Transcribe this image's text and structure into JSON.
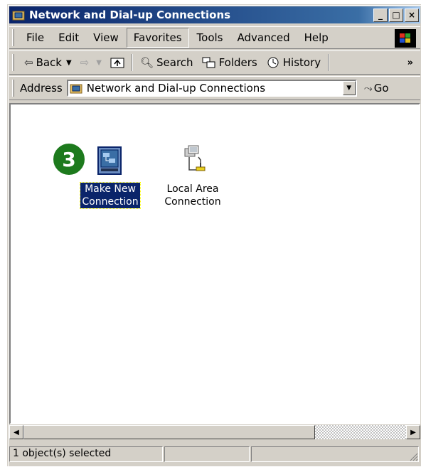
{
  "window": {
    "title": "Network and Dial-up Connections",
    "controls": {
      "minimize": "_",
      "maximize": "□",
      "close": "×"
    }
  },
  "menubar": {
    "items": [
      {
        "label": "File"
      },
      {
        "label": "Edit"
      },
      {
        "label": "View"
      },
      {
        "label": "Favorites",
        "active": true
      },
      {
        "label": "Tools"
      },
      {
        "label": "Advanced"
      },
      {
        "label": "Help"
      }
    ]
  },
  "toolbar": {
    "back": "Back",
    "search": "Search",
    "folders": "Folders",
    "history": "History",
    "more": "»"
  },
  "address": {
    "label": "Address",
    "value": "Network and Dial-up Connections",
    "go": "Go"
  },
  "content": {
    "step_badge": "3",
    "items": [
      {
        "label_line1": "Make New",
        "label_line2": "Connection",
        "icon": "make-new-connection-icon",
        "selected": true
      },
      {
        "label_line1": "Local Area",
        "label_line2": "Connection",
        "icon": "local-area-connection-icon",
        "selected": false
      }
    ]
  },
  "statusbar": {
    "text": "1 object(s) selected"
  },
  "colors": {
    "selection": "#0a246a",
    "titlebar": "#0a246a",
    "badge": "#1d7a1d",
    "chrome": "#d4d0c8"
  }
}
